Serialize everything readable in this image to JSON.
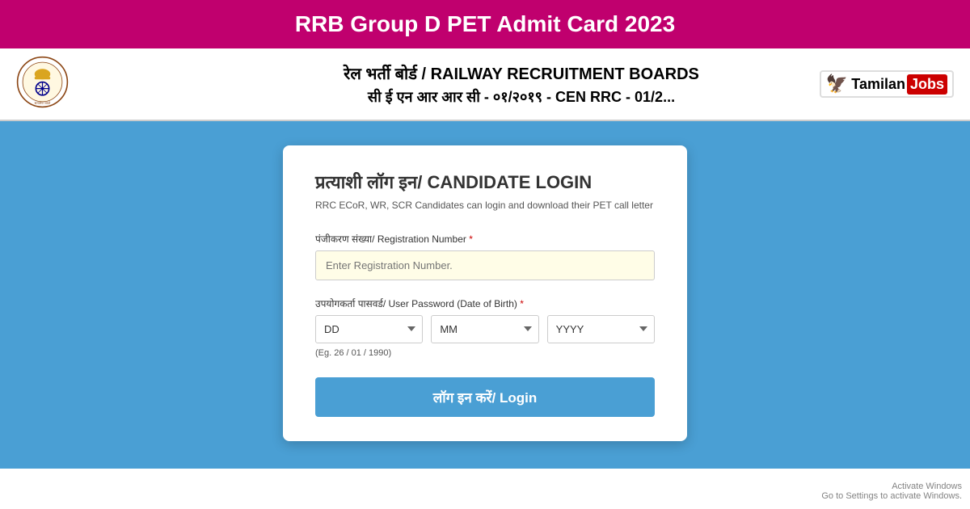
{
  "title_bar": {
    "heading": "RRB Group D PET Admit Card 2023",
    "bg_color": "#c0006e"
  },
  "header": {
    "line1": "रेल भर्ती बोर्ड / RAILWAY RECRUITMENT BOARDS",
    "line2": "सी ई एन आर आर सी - ०१/२०१९ - CEN RRC - 01/2...",
    "logo_tamilan": "Tamilan",
    "logo_jobs": "Jobs"
  },
  "login_card": {
    "title": "प्रत्याशी लॉग इन/ CANDIDATE LOGIN",
    "subtitle": "RRC ECoR, WR, SCR Candidates can login and download their PET call letter",
    "reg_label": "पंजीकरण संख्या/ Registration Number",
    "reg_required": "*",
    "reg_placeholder": "Enter Registration Number.",
    "dob_label": "उपयोगकर्ता पासवर्ड/ User Password (Date of Birth)",
    "dob_required": "*",
    "dd_option": "DD",
    "mm_option": "MM",
    "yyyy_option": "YYYY",
    "dob_hint": "(Eg. 26 / 01 / 1990)",
    "login_btn": "लॉग इन करें/ Login"
  },
  "activate_windows": {
    "line1": "Activate Windows",
    "line2": "Go to Settings to activate Windows."
  }
}
